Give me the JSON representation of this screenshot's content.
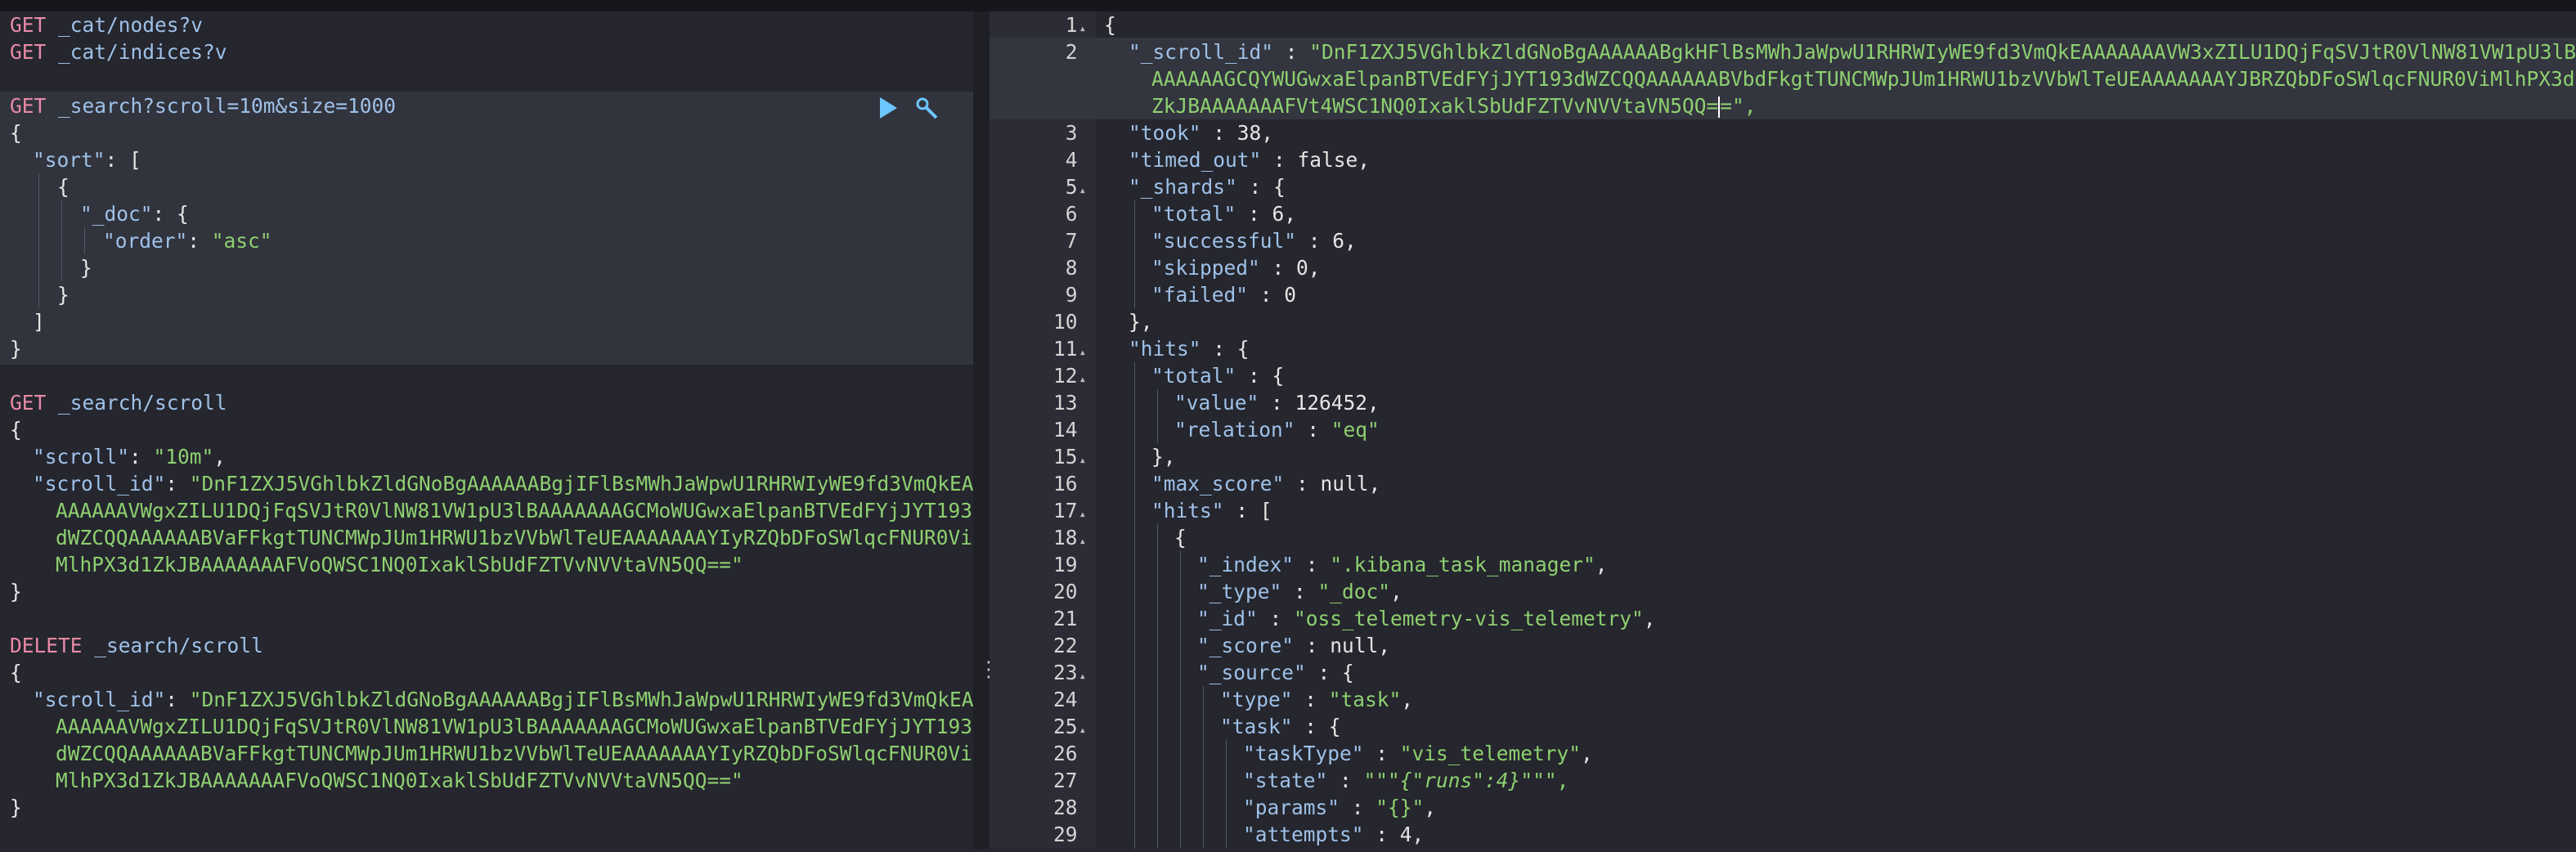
{
  "console": {
    "requests": [
      {
        "method": "GET",
        "url": "_cat/nodes?v"
      },
      {
        "method": "GET",
        "url": "_cat/indices?v"
      },
      {
        "method": "GET",
        "url": "_search?scroll=10m&size=1000"
      },
      {
        "method": "GET",
        "url": "_search/scroll"
      },
      {
        "method": "DELETE",
        "url": "_search/scroll"
      }
    ],
    "search_body": {
      "sort_key": "\"sort\"",
      "doc_key": "\"_doc\"",
      "order_key": "\"order\"",
      "order_value": "\"asc\""
    },
    "scroll_body": {
      "scroll_key": "\"scroll\"",
      "scroll_value": "\"10m\"",
      "scroll_id_key": "\"scroll_id\"",
      "scroll_id_lines": [
        "\"DnF1ZXJ5VGhlbkZldGNoBgAAAAAABgjIFlBsMWhJaWpwU1RHRWIyWE9fd3VmQkEA",
        "AAAAAAVWgxZILU1DQjFqSVJtR0VlNW81VW1pU3lBAAAAAAAGCMoWUGwxaElpanBTVEdFYjJYT193",
        "dWZCQQAAAAAABVaFFkgtTUNCMWpJUm1HRWU1bzVVbWlTeUEAAAAAAAYIyRZQbDFoSWlqcFNUR0Vi",
        "MlhPX3d1ZkJBAAAAAAAFVoQWSC1NQ0IxaklSbUdFZTVvNVVtaVN5QQ==\""
      ]
    },
    "delete_body": {
      "scroll_id_key": "\"scroll_id\"",
      "scroll_id_lines": [
        "\"DnF1ZXJ5VGhlbkZldGNoBgAAAAAABgjIFlBsMWhJaWpwU1RHRWIyWE9fd3VmQkEA",
        "AAAAAAVWgxZILU1DQjFqSVJtR0VlNW81VW1pU3lBAAAAAAAGCMoWUGwxaElpanBTVEdFYjJYT193",
        "dWZCQQAAAAAABVaFFkgtTUNCMWpJUm1HRWU1bzVVbWlTeUEAAAAAAAYIyRZQbDFoSWlqcFNUR0Vi",
        "MlhPX3d1ZkJBAAAAAAAFVoQWSC1NQ0IxaklSbUdFZTVvNVVtaVN5QQ==\""
      ]
    }
  },
  "response": {
    "line_numbers": [
      "1",
      "2",
      "3",
      "4",
      "5",
      "6",
      "7",
      "8",
      "9",
      "10",
      "11",
      "12",
      "13",
      "14",
      "15",
      "16",
      "17",
      "18",
      "19",
      "20",
      "21",
      "22",
      "23",
      "24",
      "25",
      "26",
      "27",
      "28",
      "29"
    ],
    "scroll_id_key": "\"_scroll_id\"",
    "scroll_id_lines": [
      "\"DnF1ZXJ5VGhlbkZldGNoBgAAAAAABgkHFlBsMWhJaWpwU1RHRWIyWE9fd3VmQkEAAAAAAAVW3xZILU1DQjFqSVJtR0VlNW81VW1pU3lBA",
      "AAAAAAGCQYWUGwxaElpanBTVEdFYjJYT193dWZCQQAAAAAABVbdFkgtTUNCMWpJUm1HRWU1bzVVbWlTeUEAAAAAAAYJBRZQbDFoSWlqcFNUR0ViMlhPX3d1",
      "ZkJBAAAAAAAFVt4WSC1NQ0IxaklSbUdFZTVvNVVtaVN5QQ="
    ],
    "scroll_id_tail": "=\",",
    "took_key": "\"took\"",
    "took": "38",
    "timed_out_key": "\"timed_out\"",
    "timed_out": "false",
    "shards_key": "\"_shards\"",
    "total_key": "\"total\"",
    "shards_total": "6",
    "successful_key": "\"successful\"",
    "successful": "6",
    "skipped_key": "\"skipped\"",
    "skipped": "0",
    "failed_key": "\"failed\"",
    "failed": "0",
    "hits_key": "\"hits\"",
    "value_key": "\"value\"",
    "hits_total_value": "126452",
    "relation_key": "\"relation\"",
    "relation": "\"eq\"",
    "max_score_key": "\"max_score\"",
    "max_score": "null",
    "index_key": "\"_index\"",
    "index": "\".kibana_task_manager\"",
    "type_key": "\"_type\"",
    "type": "\"_doc\"",
    "id_key": "\"_id\"",
    "id": "\"oss_telemetry-vis_telemetry\"",
    "score_key": "\"_score\"",
    "score": "null",
    "source_key": "\"_source\"",
    "src_type_key": "\"type\"",
    "src_type": "\"task\"",
    "task_key": "\"task\"",
    "task_type_key": "\"taskType\"",
    "task_type": "\"vis_telemetry\"",
    "state_key": "\"state\"",
    "state_prefix": "\"\"\"",
    "state_inner": "{\"runs\":4}",
    "state_suffix": "\"\"\",",
    "params_key": "\"params\"",
    "params": "\"{}\"",
    "attempts_key": "\"attempts\"",
    "attempts": "4"
  },
  "colors": {
    "method": "#e88aa6",
    "url": "#9fc1e8",
    "string": "#8ed070",
    "punct": "#e6e6e6",
    "accent_play": "#6dc6ff"
  },
  "icons": [
    "play-icon",
    "wrench-icon",
    "drag-handle-icon",
    "fold-arrow-icon"
  ]
}
